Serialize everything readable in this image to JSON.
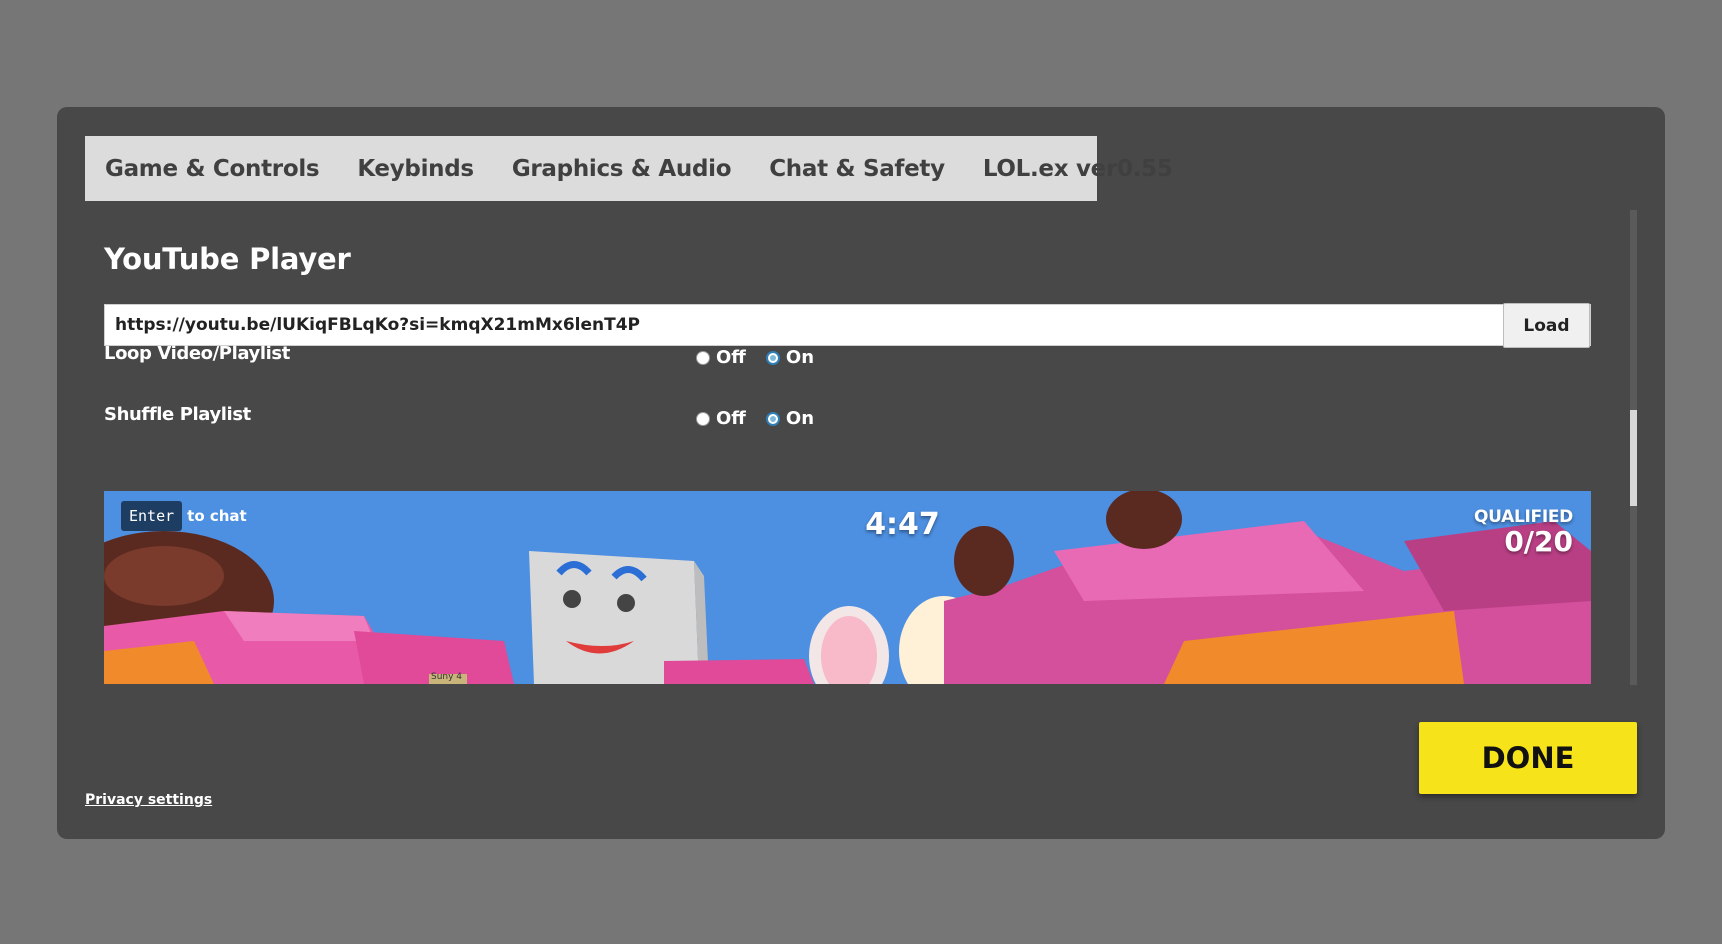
{
  "tabs": [
    "Game & Controls",
    "Keybinds",
    "Graphics & Audio",
    "Chat & Safety",
    "LOL.ex ver0.55"
  ],
  "section_title": "YouTube Player",
  "url_input": {
    "value": "https://youtu.be/lUKiqFBLqKo?si=kmqX21mMx6lenT4P"
  },
  "load_label": "Load",
  "options": [
    {
      "label": "Loop Video/Playlist",
      "off_label": "Off",
      "on_label": "On",
      "selected": "On"
    },
    {
      "label": "Shuffle Playlist",
      "off_label": "Off",
      "on_label": "On",
      "selected": "On"
    }
  ],
  "video": {
    "enter_key": "Enter",
    "to_chat": "to chat",
    "timer": "4:47",
    "qualified_label": "QUALIFIED",
    "qualified_value": "0/20",
    "sign_text": "Suny 4"
  },
  "scrollbar": {
    "position": 0.42
  },
  "done_label": "DONE",
  "privacy_label": "Privacy settings",
  "colors": {
    "background": "#767676",
    "modal": "#484848",
    "tab_bar": "#dcdcdc",
    "done": "#f7e31a",
    "sky": "#4d8fe0"
  }
}
